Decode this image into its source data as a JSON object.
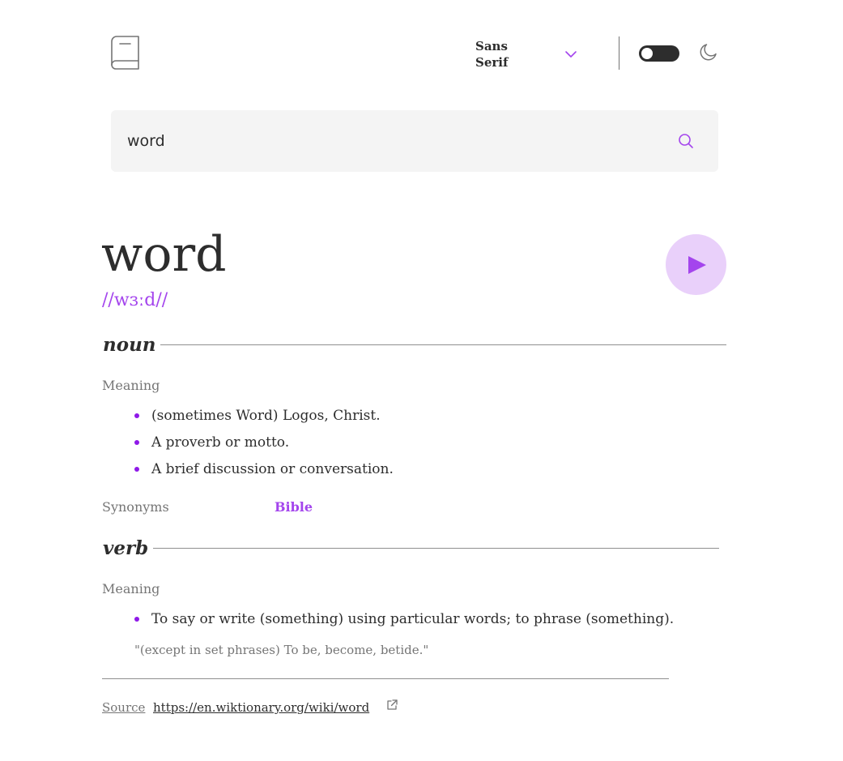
{
  "header": {
    "logo_icon": "book-icon",
    "font_select": {
      "value": "Sans Serif",
      "icon": "chevron-down-icon"
    },
    "theme_toggle": {
      "state": "off",
      "icon": "moon-icon"
    }
  },
  "search": {
    "value": "word",
    "placeholder": "",
    "icon": "search-icon"
  },
  "entry": {
    "word": "word",
    "phonetic": "//wɜːd//",
    "play_icon": "play-icon",
    "meanings": [
      {
        "part_of_speech": "noun",
        "meaning_label": "Meaning",
        "definitions": [
          "(sometimes Word) Logos, Christ.",
          "A proverb or motto.",
          "A brief discussion or conversation."
        ],
        "synonyms_label": "Synonyms",
        "synonyms": [
          "Bible"
        ]
      },
      {
        "part_of_speech": "verb",
        "meaning_label": "Meaning",
        "definitions": [
          "To say or write (something) using particular words; to phrase (something)."
        ],
        "example": "\"(except in set phrases) To be, become, betide.\""
      }
    ]
  },
  "footer": {
    "source_label": "Source",
    "source_url": "https://en.wiktionary.org/wiki/word",
    "external_icon": "external-link-icon"
  },
  "colors": {
    "accent": "#a445ed",
    "bullet": "#8f19e8",
    "play_bg": "#e9d0fa",
    "search_bg": "#f4f4f4",
    "text": "#2d2d2d",
    "muted": "#757575"
  }
}
